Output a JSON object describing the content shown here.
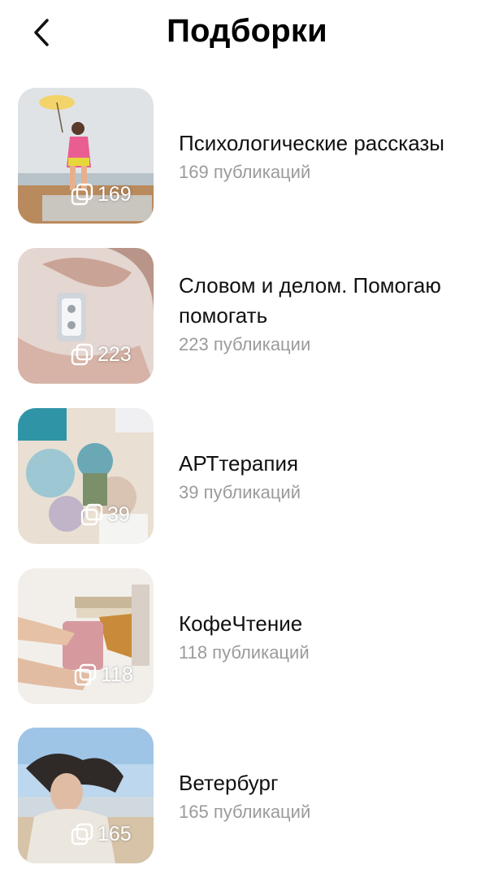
{
  "header": {
    "title": "Подборки",
    "back_icon": "chevron-left-icon"
  },
  "collections": [
    {
      "title": "Психологические рассказы",
      "subtitle": "169 публикаций",
      "count": "169",
      "colors": [
        "#e7e3dc",
        "#b6ccd8",
        "#e8548a",
        "#b8895e"
      ]
    },
    {
      "title": "Словом и делом. Помогаю помогать",
      "subtitle": "223 публикации",
      "count": "223",
      "colors": [
        "#e6d5cf",
        "#d9bcb1",
        "#cfd2d6",
        "#8c6e64"
      ]
    },
    {
      "title": "АРТтерапия",
      "subtitle": "39 публикаций",
      "count": "39",
      "colors": [
        "#6aa8b6",
        "#e8dccb",
        "#c9a98f",
        "#2e8ea0"
      ]
    },
    {
      "title": "КофеЧтение",
      "subtitle": "118 публикаций",
      "count": "118",
      "colors": [
        "#f1eeea",
        "#d89a9d",
        "#c8833c",
        "#e2c4a5"
      ]
    },
    {
      "title": "Ветербург",
      "subtitle": "165 публикаций",
      "count": "165",
      "colors": [
        "#b9d4ea",
        "#d8c8b4",
        "#2f2a28",
        "#e9e4dc"
      ]
    }
  ],
  "count_icon": "stacked-squares-icon"
}
